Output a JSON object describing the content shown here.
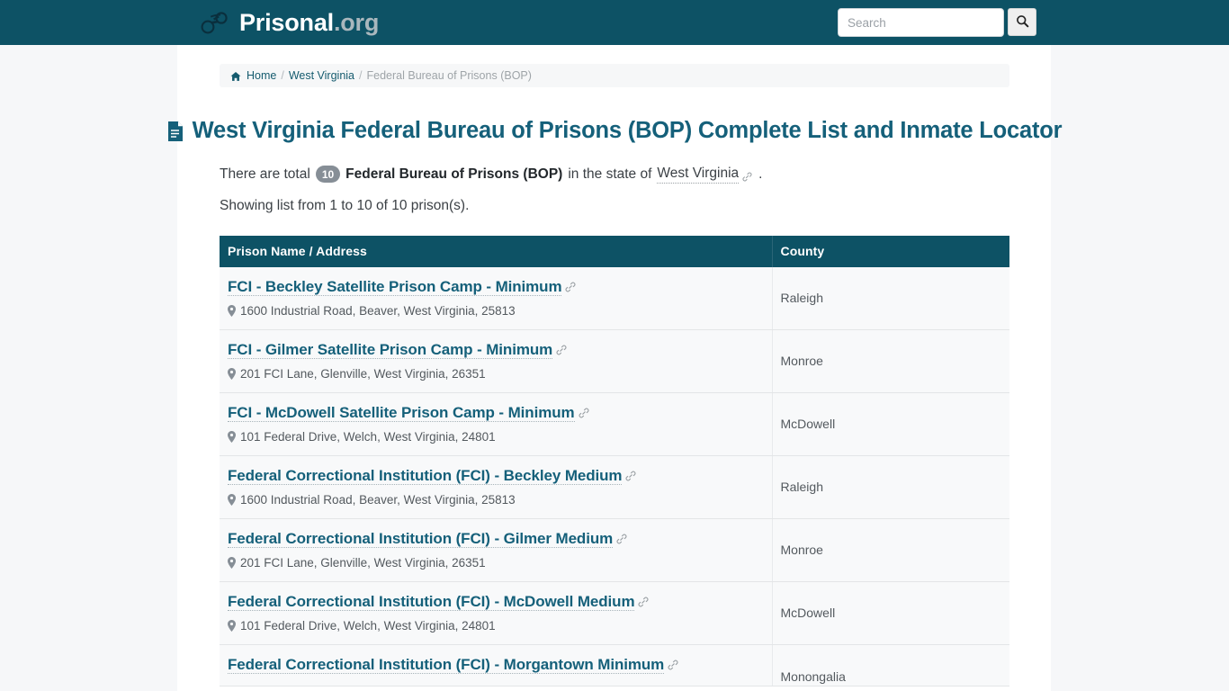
{
  "header": {
    "logo_icon": "handcuffs-icon",
    "brand_name": "Prisonal",
    "brand_tld": ".org",
    "search_placeholder": "Search",
    "search_value": "",
    "search_button_icon": "search-icon"
  },
  "breadcrumb": {
    "home_icon": "home-icon",
    "home": "Home",
    "sep1": "/",
    "state": "West Virginia",
    "sep2": "/",
    "current": "Federal Bureau of Prisons (BOP)"
  },
  "title": {
    "icon": "document-icon",
    "text": "West Virginia Federal Bureau of Prisons (BOP) Complete List and Inmate Locator"
  },
  "intro": {
    "prefix": "There are total",
    "count": "10",
    "category": "Federal Bureau of Prisons (BOP)",
    "middle": "in the state of",
    "state_link": "West Virginia",
    "link_icon": "link-icon",
    "suffix": ".",
    "showing": "Showing list from 1 to 10 of 10 prison(s)."
  },
  "table": {
    "columns": [
      "Prison Name / Address",
      "County"
    ],
    "rows": [
      {
        "name": "FCI - Beckley Satellite Prison Camp - Minimum",
        "address": "1600 Industrial Road, Beaver, West Virginia, 25813",
        "county": "Raleigh"
      },
      {
        "name": "FCI - Gilmer Satellite Prison Camp - Minimum",
        "address": "201 FCI Lane, Glenville, West Virginia, 26351",
        "county": "Monroe"
      },
      {
        "name": "FCI - McDowell Satellite Prison Camp - Minimum",
        "address": "101 Federal Drive, Welch, West Virginia, 24801",
        "county": "McDowell"
      },
      {
        "name": "Federal Correctional Institution (FCI) - Beckley Medium",
        "address": "1600 Industrial Road, Beaver, West Virginia, 25813",
        "county": "Raleigh"
      },
      {
        "name": "Federal Correctional Institution (FCI) - Gilmer Medium",
        "address": "201 FCI Lane, Glenville, West Virginia, 26351",
        "county": "Monroe"
      },
      {
        "name": "Federal Correctional Institution (FCI) - McDowell Medium",
        "address": "101 Federal Drive, Welch, West Virginia, 24801",
        "county": "McDowell"
      },
      {
        "name": "Federal Correctional Institution (FCI) - Morgantown Minimum",
        "address": "",
        "county": "Monongalia"
      }
    ]
  },
  "colors": {
    "brand_teal": "#0d5265",
    "title_teal": "#15607a",
    "badge_gray": "#868e96",
    "row_bg": "#f8f9fa",
    "page_bg": "#f6f7f9"
  }
}
